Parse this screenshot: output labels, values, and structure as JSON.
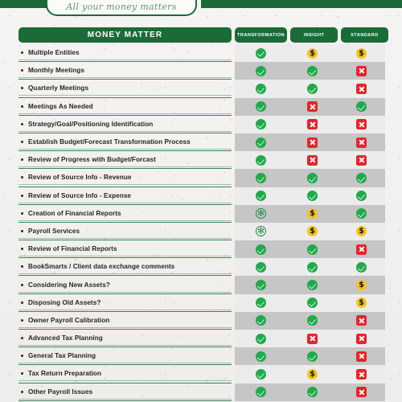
{
  "brand": {
    "tagline": "All your money matters",
    "accent_green": "#1a6b38",
    "check_green": "#1faa4b",
    "cross_red": "#e8232a",
    "dollar_yellow": "#f5c518"
  },
  "table": {
    "header": {
      "main": "MONEY MATTER",
      "plans": [
        "TRANSFORMATION",
        "INSIGHT",
        "STANDARD"
      ]
    },
    "icon_glyphs": {
      "check": "check-icon",
      "cross": "cross-icon",
      "dollar": "dollar-icon",
      "asterisk": "asterisk-icon"
    },
    "rows": [
      {
        "label": "Multiple Entities",
        "values": [
          "check",
          "dollar",
          "dollar"
        ]
      },
      {
        "label": "Monthly Meetings",
        "values": [
          "check",
          "check",
          "cross"
        ]
      },
      {
        "label": "Quarterly Meetings",
        "values": [
          "check",
          "check",
          "cross"
        ]
      },
      {
        "label": "Meetings As Needed",
        "values": [
          "check",
          "cross",
          "check"
        ]
      },
      {
        "label": "Strategy/Goal/Positioning Identification",
        "values": [
          "check",
          "cross",
          "cross"
        ]
      },
      {
        "label": "Establish Budget/Forecast Transformation Process",
        "values": [
          "check",
          "cross",
          "cross"
        ]
      },
      {
        "label": "Review of Progress with Budget/Forcast",
        "values": [
          "check",
          "cross",
          "cross"
        ]
      },
      {
        "label": "Review of Source Info - Revenue",
        "values": [
          "check",
          "check",
          "check"
        ]
      },
      {
        "label": "Review of Source Info - Expense",
        "values": [
          "check",
          "check",
          "check"
        ]
      },
      {
        "label": "Creation of Financial Reports",
        "values": [
          "asterisk",
          "dollar",
          "check"
        ]
      },
      {
        "label": "Payroll Services",
        "values": [
          "asterisk",
          "dollar",
          "dollar"
        ]
      },
      {
        "label": "Review of Financial Reports",
        "values": [
          "check",
          "check",
          "cross"
        ]
      },
      {
        "label": "BookSmarts / Client data exchange comments",
        "values": [
          "check",
          "check",
          "check"
        ]
      },
      {
        "label": "Considering New Assets?",
        "values": [
          "check",
          "check",
          "dollar"
        ]
      },
      {
        "label": "Disposing Old Assets?",
        "values": [
          "check",
          "check",
          "dollar"
        ]
      },
      {
        "label": "Owner Payroll Calibration",
        "values": [
          "check",
          "check",
          "cross"
        ]
      },
      {
        "label": "Advanced Tax Planning",
        "values": [
          "check",
          "cross",
          "cross"
        ]
      },
      {
        "label": "General Tax Planning",
        "values": [
          "check",
          "check",
          "cross"
        ]
      },
      {
        "label": "Tax Return Preparation",
        "values": [
          "check",
          "dollar",
          "cross"
        ]
      },
      {
        "label": "Other Payroll Issues",
        "values": [
          "check",
          "check",
          "cross"
        ]
      }
    ]
  }
}
